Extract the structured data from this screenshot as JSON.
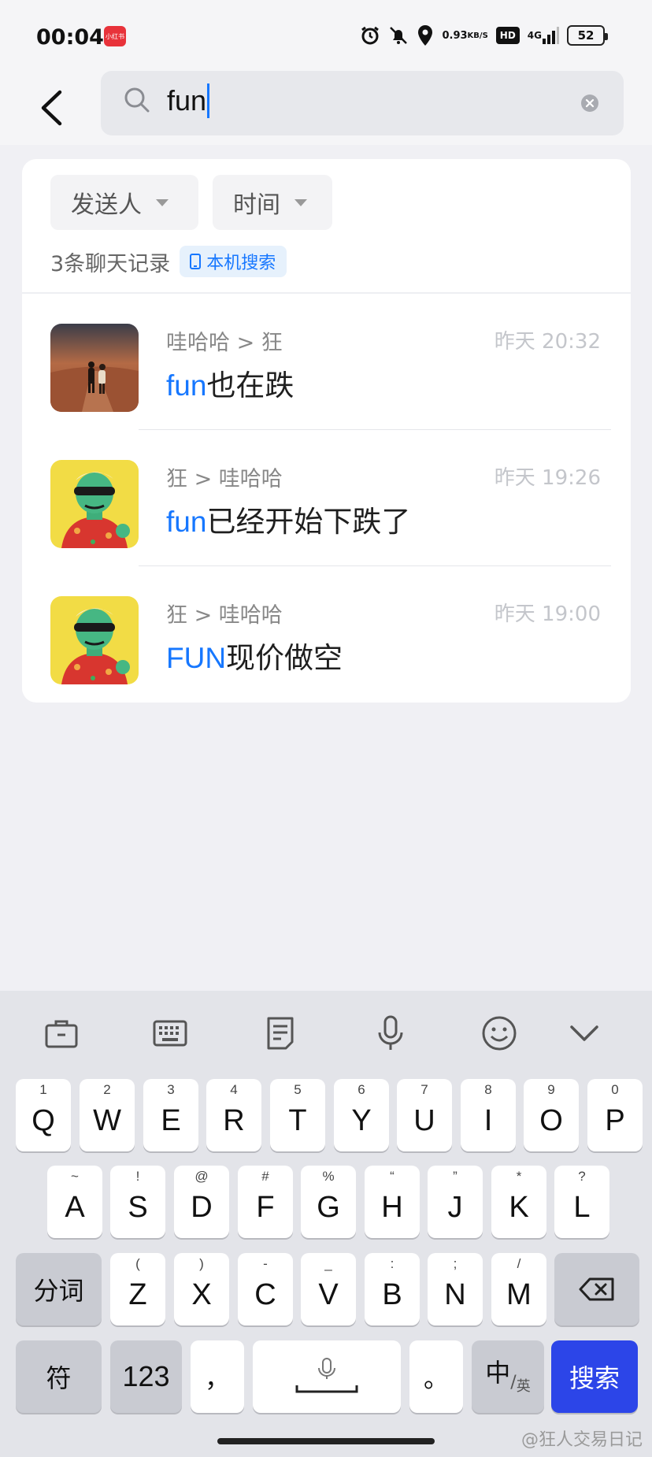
{
  "status_bar": {
    "time": "00:04",
    "app_badge": "小红书",
    "net_speed_value": "0.93",
    "net_speed_unit": "KB/S",
    "hd_label": "HD",
    "network": "4G",
    "battery": "52"
  },
  "search": {
    "query": "fun"
  },
  "filters": {
    "sender_label": "发送人",
    "time_label": "时间"
  },
  "results_summary": {
    "count_text": "3条聊天记录",
    "local_search_label": "本机搜索"
  },
  "results": [
    {
      "route": "哇哈哈 > 狂",
      "time": "昨天 20:32",
      "highlight": "fun",
      "rest": "也在跌"
    },
    {
      "route": "狂 > 哇哈哈",
      "time": "昨天 19:26",
      "highlight": "fun",
      "rest": "已经开始下跌了"
    },
    {
      "route": "狂 > 哇哈哈",
      "time": "昨天 19:00",
      "highlight": "FUN",
      "rest": "现价做空"
    }
  ],
  "keyboard": {
    "row1": [
      {
        "key": "Q",
        "hint": "1"
      },
      {
        "key": "W",
        "hint": "2"
      },
      {
        "key": "E",
        "hint": "3"
      },
      {
        "key": "R",
        "hint": "4"
      },
      {
        "key": "T",
        "hint": "5"
      },
      {
        "key": "Y",
        "hint": "6"
      },
      {
        "key": "U",
        "hint": "7"
      },
      {
        "key": "I",
        "hint": "8"
      },
      {
        "key": "O",
        "hint": "9"
      },
      {
        "key": "P",
        "hint": "0"
      }
    ],
    "row2": [
      {
        "key": "A",
        "hint": "~"
      },
      {
        "key": "S",
        "hint": "!"
      },
      {
        "key": "D",
        "hint": "@"
      },
      {
        "key": "F",
        "hint": "#"
      },
      {
        "key": "G",
        "hint": "%"
      },
      {
        "key": "H",
        "hint": "“"
      },
      {
        "key": "J",
        "hint": "”"
      },
      {
        "key": "K",
        "hint": "*"
      },
      {
        "key": "L",
        "hint": "?"
      }
    ],
    "row3": [
      {
        "key": "Z",
        "hint": "("
      },
      {
        "key": "X",
        "hint": ")"
      },
      {
        "key": "C",
        "hint": "-"
      },
      {
        "key": "V",
        "hint": "_"
      },
      {
        "key": "B",
        "hint": ":"
      },
      {
        "key": "N",
        "hint": ";"
      },
      {
        "key": "M",
        "hint": "/"
      }
    ],
    "segment_label": "分词",
    "symbol_label": "符",
    "number_label": "123",
    "comma_label": "，",
    "period_label": "。",
    "lang_main": "中",
    "lang_sub": "英",
    "search_label": "搜索"
  },
  "watermark": "@狂人交易日记"
}
